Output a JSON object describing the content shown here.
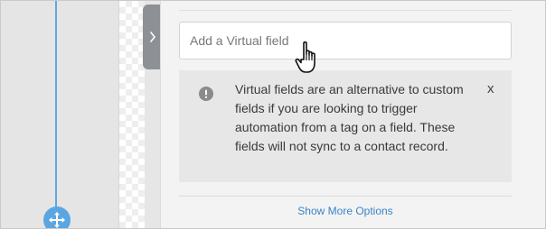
{
  "virtual_field": {
    "placeholder": "Add a Virtual field",
    "info_text": "Virtual fields are an alternative to custom fields if you are looking to trigger automation from a tag on a field. These fields will not sync to a contact record.",
    "close_label": "x"
  },
  "footer": {
    "show_more_label": "Show More Options"
  },
  "icons": {
    "collapse": "chevron-right-icon",
    "info": "exclamation-circle-icon",
    "move": "move-arrows-icon",
    "cursor": "hand-pointer-icon"
  },
  "colors": {
    "accent": "#5aa6e3",
    "link": "#3a84c7",
    "info_bg": "#e7e7e7",
    "tab": "#8d9094"
  }
}
